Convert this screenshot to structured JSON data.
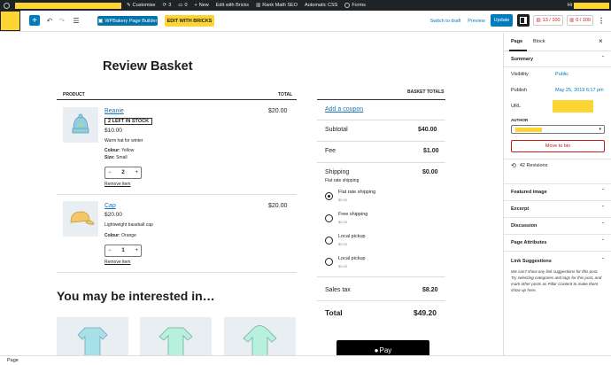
{
  "adminbar": {
    "customise": "Customise",
    "comments_count": "3",
    "pending_count": "0",
    "new": "New",
    "edit_bricks": "Edit with Bricks",
    "rank_math": "Rank Math SEO",
    "automatic_css": "Automatic CSS",
    "forms": "Forms",
    "hi": "Hi"
  },
  "toolbar": {
    "wpbakery": "WPBakery Page Builder",
    "edit_bricks": "EDIT WITH BRICKS",
    "switch_draft": "Switch to draft",
    "preview": "Preview",
    "update": "Update",
    "score1": "13 / 100",
    "score2": "0 / 100"
  },
  "page": {
    "title": "Review Basket",
    "col_product": "PRODUCT",
    "col_total": "TOTAL",
    "basket_totals": "BASKET TOTALS"
  },
  "items": [
    {
      "name": "Beanie",
      "stock": "2 LEFT IN STOCK",
      "price": "$10.00",
      "desc": "Warm hat for winter",
      "attr1_label": "Colour:",
      "attr1_value": "Yellow",
      "attr2_label": "Size:",
      "attr2_value": "Small",
      "qty": "2",
      "remove": "Remove item",
      "total": "$20.00"
    },
    {
      "name": "Cap",
      "price": "$20.00",
      "desc": "Lightweight baseball cap",
      "attr1_label": "Colour:",
      "attr1_value": "Orange",
      "qty": "1",
      "remove": "Remove item",
      "total": "$20.00"
    }
  ],
  "totals": {
    "coupon": "Add a coupon",
    "subtotal_label": "Subtotal",
    "subtotal": "$40.00",
    "fee_label": "Fee",
    "fee": "$1.00",
    "shipping_label": "Shipping",
    "shipping": "$0.00",
    "shipping_sub": "Flat rate shipping",
    "options": [
      {
        "label": "Flat rate shipping",
        "price": "$5.00",
        "selected": true
      },
      {
        "label": "Free shipping",
        "price": "$0.00",
        "selected": false
      },
      {
        "label": "Local pickup",
        "price": "$0.00",
        "selected": false
      },
      {
        "label": "Local pickup",
        "price": "$0.00",
        "selected": false
      }
    ],
    "tax_label": "Sales tax",
    "tax": "$8.20",
    "total_label": "Total",
    "total": "$49.20",
    "pay_label": "Pay"
  },
  "related": {
    "heading": "You may be interested in…"
  },
  "sidebar": {
    "tab_page": "Page",
    "tab_block": "Block",
    "summary": "Summary",
    "visibility_label": "Visibility",
    "visibility_value": "Public",
    "publish_label": "Publish",
    "publish_value": "May 25, 2019 6:17 pm",
    "url_label": "URL",
    "author_label": "AUTHOR",
    "move_trash": "Move to bin",
    "revisions": "42 Revisions",
    "featured_image": "Featured image",
    "excerpt": "Excerpt",
    "discussion": "Discussion",
    "page_attributes": "Page Attributes",
    "link_suggestions": "Link Suggestions",
    "link_text": "We can't show any link suggestions for this post. Try selecting categories and tags for this post, and mark other posts as Pillar Content to make them show up here."
  },
  "footer": {
    "label": "Page"
  },
  "colors": {
    "accent": "#007cba",
    "brand_yellow": "#fcd535",
    "danger": "#cc1818"
  }
}
